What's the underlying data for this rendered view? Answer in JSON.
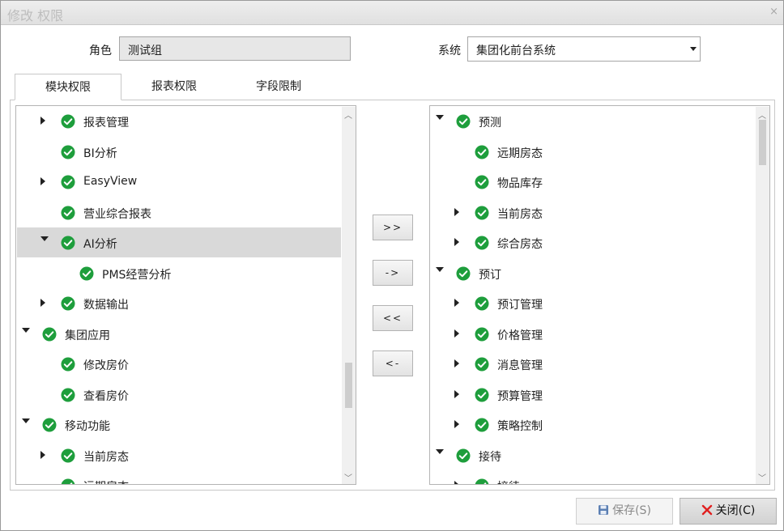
{
  "dialog": {
    "title": "修改 权限",
    "close_glyph": "×"
  },
  "form": {
    "role_label": "角色",
    "role_value": "测试组",
    "system_label": "系统",
    "system_value": "集团化前台系统"
  },
  "tabs": [
    {
      "label": "模块权限",
      "active": true
    },
    {
      "label": "报表权限",
      "active": false
    },
    {
      "label": "字段限制",
      "active": false
    }
  ],
  "left_tree": [
    {
      "label": "报表管理",
      "level": 1,
      "expander": "collapsed",
      "selected": false
    },
    {
      "label": "BI分析",
      "level": 1,
      "expander": "none",
      "selected": false
    },
    {
      "label": "EasyView",
      "level": 1,
      "expander": "collapsed",
      "selected": false
    },
    {
      "label": "营业综合报表",
      "level": 1,
      "expander": "none",
      "selected": false
    },
    {
      "label": "AI分析",
      "level": 1,
      "expander": "expanded",
      "selected": true
    },
    {
      "label": "PMS经营分析",
      "level": 2,
      "expander": "none",
      "selected": false
    },
    {
      "label": "数据输出",
      "level": 1,
      "expander": "collapsed",
      "selected": false
    },
    {
      "label": "集团应用",
      "level": 0,
      "expander": "expanded",
      "selected": false
    },
    {
      "label": "修改房价",
      "level": 1,
      "expander": "none",
      "selected": false
    },
    {
      "label": "查看房价",
      "level": 1,
      "expander": "none",
      "selected": false
    },
    {
      "label": "移动功能",
      "level": 0,
      "expander": "expanded",
      "selected": false
    },
    {
      "label": "当前房态",
      "level": 1,
      "expander": "collapsed",
      "selected": false
    },
    {
      "label": "远期房态",
      "level": 1,
      "expander": "none",
      "selected": false
    }
  ],
  "right_tree": [
    {
      "label": "预测",
      "level": 0,
      "expander": "expanded"
    },
    {
      "label": "远期房态",
      "level": 1,
      "expander": "none"
    },
    {
      "label": "物品库存",
      "level": 1,
      "expander": "none"
    },
    {
      "label": "当前房态",
      "level": 1,
      "expander": "collapsed"
    },
    {
      "label": "综合房态",
      "level": 1,
      "expander": "collapsed"
    },
    {
      "label": "预订",
      "level": 0,
      "expander": "expanded"
    },
    {
      "label": "预订管理",
      "level": 1,
      "expander": "collapsed"
    },
    {
      "label": "价格管理",
      "level": 1,
      "expander": "collapsed"
    },
    {
      "label": "消息管理",
      "level": 1,
      "expander": "collapsed"
    },
    {
      "label": "预算管理",
      "level": 1,
      "expander": "collapsed"
    },
    {
      "label": "策略控制",
      "level": 1,
      "expander": "collapsed"
    },
    {
      "label": "接待",
      "level": 0,
      "expander": "expanded"
    },
    {
      "label": "接待",
      "level": 1,
      "expander": "collapsed"
    }
  ],
  "transfer_buttons": {
    "add_all": ">>",
    "add": "->",
    "remove_all": "<<",
    "remove": "<-"
  },
  "footer": {
    "save_label": "保存(S)",
    "close_label": "关闭(C)"
  },
  "colors": {
    "check_green": "#1e9e3c",
    "selected_row": "#d9d9d9",
    "close_red": "#e02020",
    "save_blue": "#5b7fb3"
  }
}
